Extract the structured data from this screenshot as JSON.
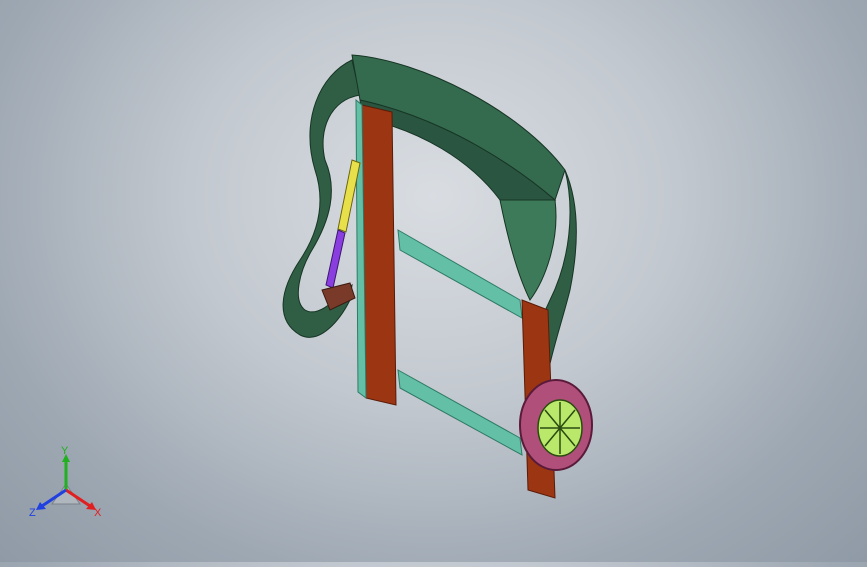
{
  "triad": {
    "x_label": "X",
    "y_label": "Y",
    "z_label": "Z"
  },
  "colors": {
    "cover": "#2f5e45",
    "cover_shadow": "#1f4532",
    "post": "#9c3512",
    "frame": "#63c0a6",
    "cylinder": "#e8e04a",
    "rod": "#8a3ee0",
    "wheel_tire": "#b0507a",
    "wheel_hub": "#b9e86a",
    "axis_x": "#e02020",
    "axis_y": "#20b020",
    "axis_z": "#2040e0"
  },
  "icons": {
    "triad": "view-orientation-triad-icon"
  }
}
